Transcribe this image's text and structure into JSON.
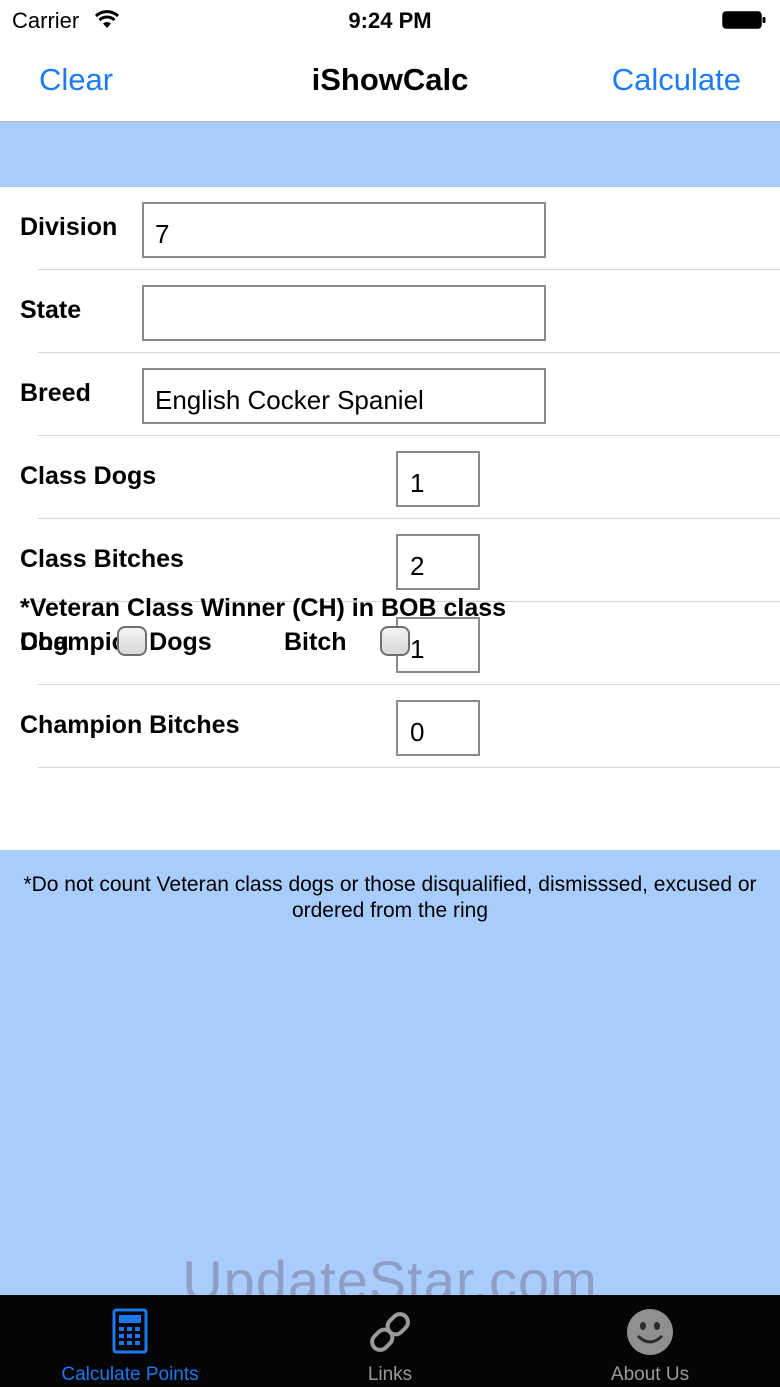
{
  "status": {
    "carrier": "Carrier",
    "time": "9:24 PM"
  },
  "nav": {
    "left_button": "Clear",
    "title": "iShowCalc",
    "right_button": "Calculate"
  },
  "form": {
    "division": {
      "label": "Division",
      "value": "7"
    },
    "state": {
      "label": "State",
      "value": ""
    },
    "breed": {
      "label": "Breed",
      "value": "English Cocker Spaniel"
    },
    "class_dogs": {
      "label": "Class Dogs",
      "value": "1"
    },
    "class_bitches": {
      "label": "Class Bitches",
      "value": "2"
    },
    "champion_dogs": {
      "label": "Champion Dogs",
      "value": "1"
    },
    "champion_bitches": {
      "label": "Champion Bitches",
      "value": "0"
    }
  },
  "veteran": {
    "title": "*Veteran Class Winner (CH) in BOB class",
    "dog_label": "Dog",
    "bitch_label": "Bitch",
    "dog_checked": false,
    "bitch_checked": false
  },
  "note": "*Do not count Veteran class dogs or those disqualified, dismisssed, excused or ordered from the ring",
  "watermark": "UpdateStar.com",
  "tabs": [
    {
      "label": "Calculate Points",
      "icon": "calculator-icon",
      "active": true
    },
    {
      "label": "Links",
      "icon": "chain-link-icon",
      "active": false
    },
    {
      "label": "About Us",
      "icon": "smiley-face-icon",
      "active": false
    }
  ],
  "colors": {
    "accent": "#1a7cf5",
    "background": "#a8cdfd",
    "tabbar": "#050505"
  }
}
